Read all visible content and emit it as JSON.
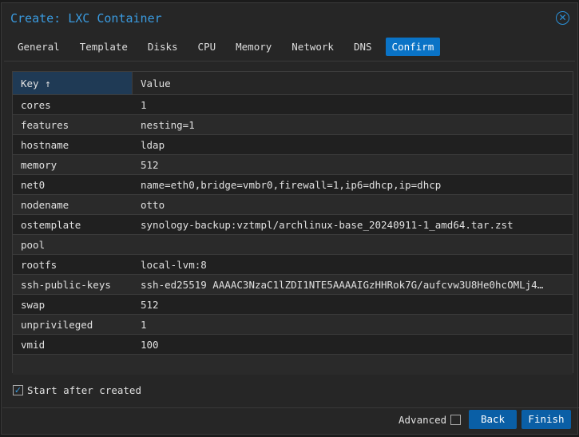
{
  "title": "Create: LXC Container",
  "tabs": [
    "General",
    "Template",
    "Disks",
    "CPU",
    "Memory",
    "Network",
    "DNS",
    "Confirm"
  ],
  "active_tab": "Confirm",
  "columns": {
    "key": "Key",
    "sort_icon": "↑",
    "value": "Value"
  },
  "rows": [
    {
      "key": "cores",
      "value": "1"
    },
    {
      "key": "features",
      "value": "nesting=1"
    },
    {
      "key": "hostname",
      "value": "ldap"
    },
    {
      "key": "memory",
      "value": "512"
    },
    {
      "key": "net0",
      "value": "name=eth0,bridge=vmbr0,firewall=1,ip6=dhcp,ip=dhcp"
    },
    {
      "key": "nodename",
      "value": "otto"
    },
    {
      "key": "ostemplate",
      "value": "synology-backup:vztmpl/archlinux-base_20240911-1_amd64.tar.zst"
    },
    {
      "key": "pool",
      "value": ""
    },
    {
      "key": "rootfs",
      "value": "local-lvm:8"
    },
    {
      "key": "ssh-public-keys",
      "value": "ssh-ed25519 AAAAC3NzaC1lZDI1NTE5AAAAIGzHHRok7G/aufcvw3U8He0hcOMLj4…"
    },
    {
      "key": "swap",
      "value": "512"
    },
    {
      "key": "unprivileged",
      "value": "1"
    },
    {
      "key": "vmid",
      "value": "100"
    }
  ],
  "start_after_created": {
    "label": "Start after created",
    "checked": true
  },
  "advanced": {
    "label": "Advanced",
    "checked": false
  },
  "buttons": {
    "back": "Back",
    "finish": "Finish"
  }
}
